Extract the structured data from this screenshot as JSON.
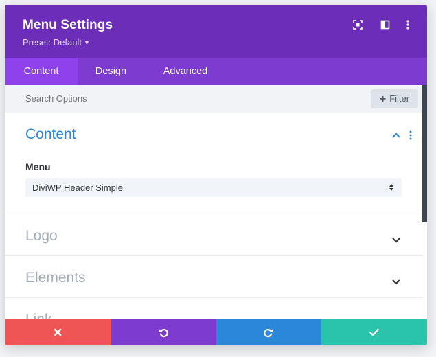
{
  "header": {
    "title": "Menu Settings",
    "preset_label": "Preset: Default",
    "icons": [
      "fullscreen-icon",
      "split-view-icon",
      "more-options-icon"
    ],
    "bg_color": "#6c2eb9"
  },
  "tabs": [
    {
      "label": "Content",
      "active": true
    },
    {
      "label": "Design",
      "active": false
    },
    {
      "label": "Advanced",
      "active": false
    }
  ],
  "search": {
    "placeholder": "Search Options",
    "filter_label": "Filter"
  },
  "sections": [
    {
      "title": "Content",
      "expanded": true,
      "fields": [
        {
          "label": "Menu",
          "value": "DiviWP Header Simple"
        }
      ]
    },
    {
      "title": "Logo",
      "expanded": false
    },
    {
      "title": "Elements",
      "expanded": false
    },
    {
      "title": "Link",
      "expanded": false
    }
  ],
  "footer": {
    "buttons": [
      {
        "icon": "close-icon",
        "color": "#ef5555"
      },
      {
        "icon": "undo-icon",
        "color": "#7e3bd0"
      },
      {
        "icon": "redo-icon",
        "color": "#2b87da"
      },
      {
        "icon": "check-icon",
        "color": "#29c4a9"
      }
    ]
  },
  "colors": {
    "accent": "#2b87da",
    "header": "#6c2eb9",
    "tabs": "#7e3bd0",
    "tab_active": "#8f42ec"
  }
}
